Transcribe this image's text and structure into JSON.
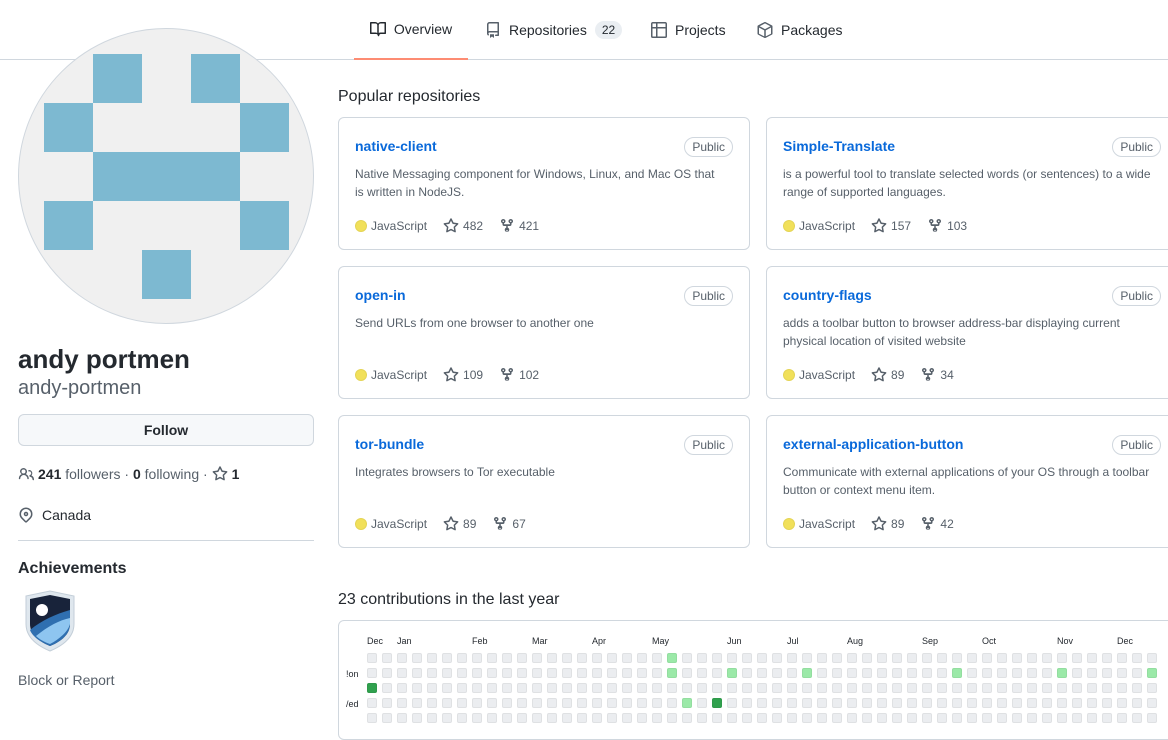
{
  "nav": {
    "tabs": [
      {
        "label": "Overview",
        "icon": "book-icon",
        "selected": true
      },
      {
        "label": "Repositories",
        "icon": "repo-icon",
        "count": "22"
      },
      {
        "label": "Projects",
        "icon": "table-icon"
      },
      {
        "label": "Packages",
        "icon": "package-icon"
      }
    ]
  },
  "profile": {
    "fullname": "andy portmen",
    "username": "andy-portmen",
    "follow_label": "Follow",
    "followers": "241",
    "followers_label": "followers",
    "following": "0",
    "following_label": "following",
    "stars": "1",
    "location": "Canada",
    "achievements_title": "Achievements",
    "block_report": "Block or Report",
    "avatar_color": "#7db9d1"
  },
  "popular": {
    "title": "Popular repositories",
    "repos": [
      {
        "name": "native-client",
        "visibility": "Public",
        "description": "Native Messaging component for Windows, Linux, and Mac OS that is written in NodeJS.",
        "language": "JavaScript",
        "stars": "482",
        "forks": "421"
      },
      {
        "name": "Simple-Translate",
        "visibility": "Public",
        "description": "is a powerful tool to translate selected words (or sentences) to a wide range of supported languages.",
        "language": "JavaScript",
        "stars": "157",
        "forks": "103"
      },
      {
        "name": "open-in",
        "visibility": "Public",
        "description": "Send URLs from one browser to another one",
        "language": "JavaScript",
        "stars": "109",
        "forks": "102"
      },
      {
        "name": "country-flags",
        "visibility": "Public",
        "description": "adds a toolbar button to browser address-bar displaying current physical location of visited website",
        "language": "JavaScript",
        "stars": "89",
        "forks": "34"
      },
      {
        "name": "tor-bundle",
        "visibility": "Public",
        "description": "Integrates browsers to Tor executable",
        "language": "JavaScript",
        "stars": "89",
        "forks": "67"
      },
      {
        "name": "external-application-button",
        "visibility": "Public",
        "description": "Communicate with external applications of your OS through a toolbar button or context menu item.",
        "language": "JavaScript",
        "stars": "89",
        "forks": "42"
      }
    ],
    "language_color": "#f1e05a"
  },
  "contributions": {
    "title": "23 contributions in the last year",
    "months": [
      "Dec",
      "Jan",
      "Feb",
      "Mar",
      "Apr",
      "May",
      "Jun",
      "Jul",
      "Aug",
      "Sep",
      "Oct",
      "Nov",
      "Dec"
    ],
    "day_labels": [
      "!on",
      "/ed"
    ],
    "colors": {
      "empty": "#ebedf0",
      "level1": "#9be9a8",
      "level3": "#30a14e"
    }
  }
}
